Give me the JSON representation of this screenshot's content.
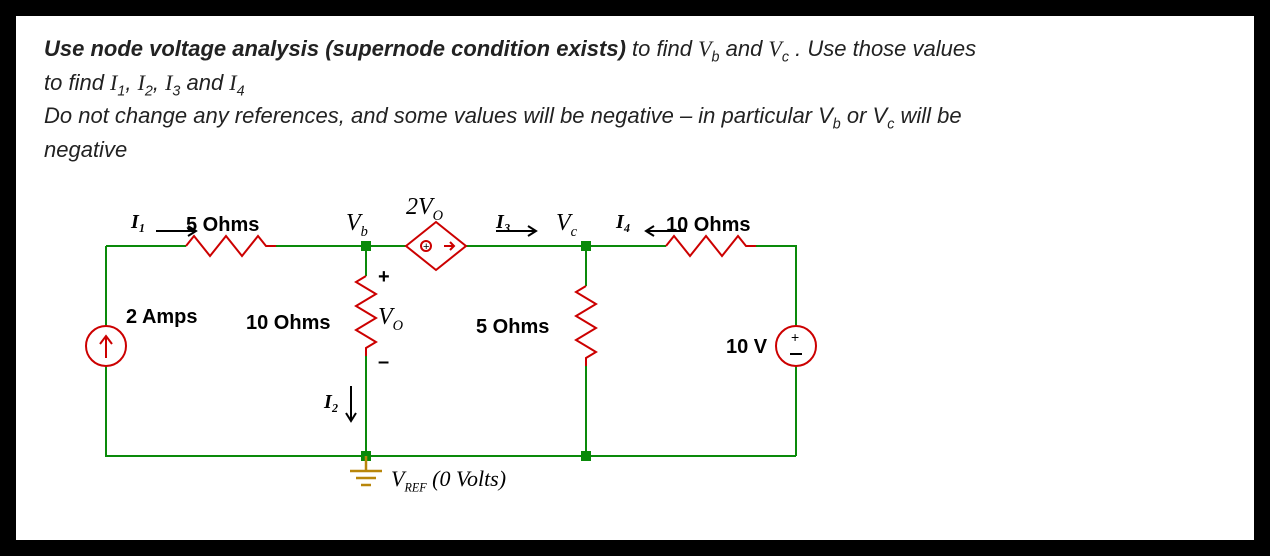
{
  "problem": {
    "line1_bold": "Use node voltage analysis (supernode condition exists)",
    "line1_rest": " to find ",
    "vb": "V",
    "vb_sub": "b",
    "and1": " and ",
    "vc": "V",
    "vc_sub": "c",
    "line1_end": " .  Use those values",
    "line2_pre": "to find ",
    "I1": "I",
    "I1sub": "1",
    "comma1": ", ",
    "I2": "I",
    "I2sub": "2",
    "comma2": ", ",
    "I3": "I",
    "I3sub": "3",
    "and2": " and ",
    "I4": "I",
    "I4sub": "4",
    "line3": "Do not change any references, and some values will be negative – in particular V",
    "line3_bsub": "b",
    "line3_mid": " or V",
    "line3_csub": "c",
    "line3_end": " will be",
    "line4": "negative"
  },
  "labels": {
    "I1top": "I₁",
    "R5top": "5 Ohms",
    "Vb": "V",
    "Vb_sub": "b",
    "twoVo": "2V",
    "twoVo_sub": "O",
    "I3top": "I₃",
    "Vc": "V",
    "Vc_sub": "c",
    "I4top": "I₄",
    "R10top": "10 Ohms",
    "Isrc": "2 Amps",
    "R10mid": "10 Ohms",
    "Vo": "V",
    "Vo_sub": "O",
    "plus": "+",
    "minus": "–",
    "R5mid": "5 Ohms",
    "V10": "10 V",
    "VplusR": "+",
    "I2lbl": "I₂",
    "Vref_pre": "V",
    "Vref_sub": "REF",
    "Vref_post": " (0 Volts)"
  },
  "circuit": {
    "nodes": [
      "Vb",
      "Vc",
      "Vref"
    ],
    "sources": [
      {
        "type": "current",
        "value_A": 2
      },
      {
        "type": "dependent_voltage",
        "expression": "2*Vo"
      },
      {
        "type": "voltage",
        "value_V": 10
      }
    ],
    "resistors_ohms": [
      5,
      10,
      5,
      10
    ],
    "controlling_variable": "Vo across 10 Ohm"
  }
}
